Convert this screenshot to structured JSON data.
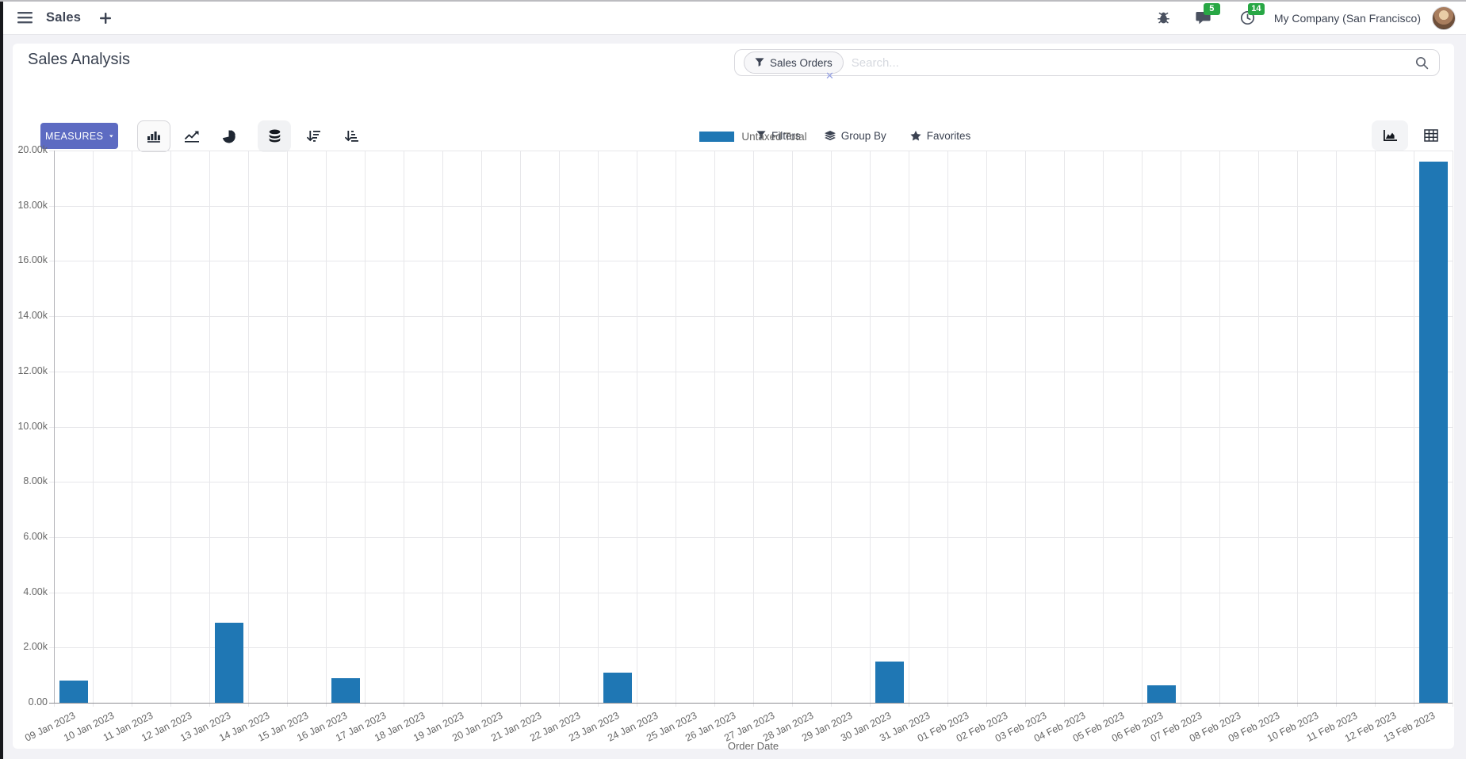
{
  "navbar": {
    "app_menu_label": "Sales",
    "chat_badge": "5",
    "activity_badge": "14",
    "company": "My Company (San Francisco)"
  },
  "control_panel": {
    "title": "Sales Analysis",
    "measures_label": "MEASURES",
    "facet_label": "Sales Orders",
    "search_placeholder": "Search...",
    "filters_label": "Filters",
    "group_by_label": "Group By",
    "favorites_label": "Favorites"
  },
  "colors": {
    "accent": "#5d6bc2",
    "badge_green": "#28a745",
    "bar_blue": "#1f77b4"
  },
  "chart_data": {
    "type": "bar",
    "title": "",
    "xlabel": "Order Date",
    "ylabel": "",
    "ylim": [
      0,
      20000
    ],
    "y_tick_step": 2000,
    "grid": true,
    "legend_position": "top",
    "categories": [
      "09 Jan 2023",
      "10 Jan 2023",
      "11 Jan 2023",
      "12 Jan 2023",
      "13 Jan 2023",
      "14 Jan 2023",
      "15 Jan 2023",
      "16 Jan 2023",
      "17 Jan 2023",
      "18 Jan 2023",
      "19 Jan 2023",
      "20 Jan 2023",
      "21 Jan 2023",
      "22 Jan 2023",
      "23 Jan 2023",
      "24 Jan 2023",
      "25 Jan 2023",
      "26 Jan 2023",
      "27 Jan 2023",
      "28 Jan 2023",
      "29 Jan 2023",
      "30 Jan 2023",
      "31 Jan 2023",
      "01 Feb 2023",
      "02 Feb 2023",
      "03 Feb 2023",
      "04 Feb 2023",
      "05 Feb 2023",
      "06 Feb 2023",
      "07 Feb 2023",
      "08 Feb 2023",
      "09 Feb 2023",
      "10 Feb 2023",
      "11 Feb 2023",
      "12 Feb 2023",
      "13 Feb 2023"
    ],
    "series": [
      {
        "name": "Untaxed Total",
        "color": "#1f77b4",
        "values": [
          800,
          0,
          0,
          0,
          2900,
          0,
          0,
          900,
          0,
          0,
          0,
          0,
          0,
          0,
          1080,
          0,
          0,
          0,
          0,
          0,
          0,
          1500,
          0,
          0,
          0,
          0,
          0,
          0,
          640,
          0,
          0,
          0,
          0,
          0,
          0,
          19600
        ]
      }
    ]
  }
}
